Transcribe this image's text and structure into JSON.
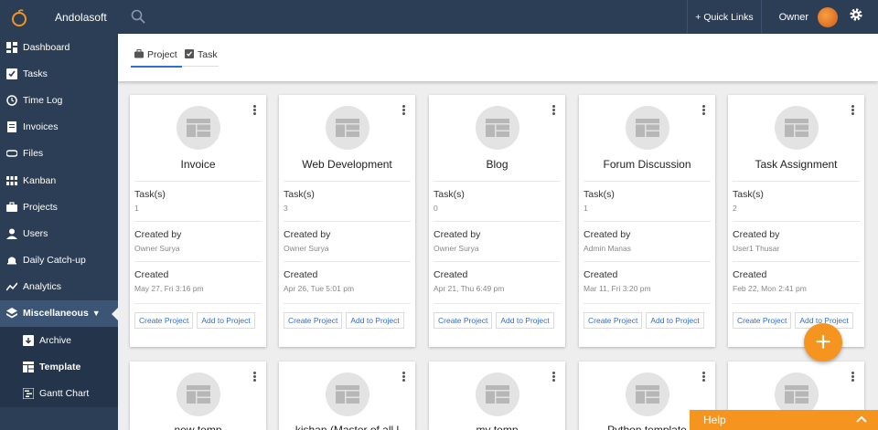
{
  "app": {
    "brand_name": "Andolasoft",
    "logo_icon": "orange-fruit-logo"
  },
  "sidebar": {
    "items": [
      {
        "label": "Dashboard",
        "icon": "dashboard-icon"
      },
      {
        "label": "Tasks",
        "icon": "tasks-icon"
      },
      {
        "label": "Time Log",
        "icon": "clock-icon"
      },
      {
        "label": "Invoices",
        "icon": "invoice-icon"
      },
      {
        "label": "Files",
        "icon": "paperclip-icon"
      },
      {
        "label": "Kanban",
        "icon": "kanban-icon"
      },
      {
        "label": "Projects",
        "icon": "briefcase-icon"
      },
      {
        "label": "Users",
        "icon": "user-icon"
      },
      {
        "label": "Daily Catch-up",
        "icon": "alarm-icon"
      },
      {
        "label": "Analytics",
        "icon": "analytics-icon"
      },
      {
        "label": "Miscellaneous",
        "icon": "layers-icon"
      }
    ],
    "sub_items": [
      {
        "label": "Archive",
        "icon": "archive-icon"
      },
      {
        "label": "Template",
        "icon": "template-icon"
      },
      {
        "label": "Gantt Chart",
        "icon": "gantt-icon"
      }
    ]
  },
  "topbar": {
    "quick_links": "+ Quick Links",
    "owner": "Owner"
  },
  "tabs": {
    "project": "Project",
    "task": "Task"
  },
  "labels": {
    "tasks": "Task(s)",
    "created_by": "Created by",
    "created": "Created",
    "create_project": "Create Project",
    "add_to_project": "Add to Project"
  },
  "cards": [
    {
      "title": "Invoice",
      "tasks": "1",
      "created_by": "Owner Surya",
      "created": "May 27, Fri 3:16 pm"
    },
    {
      "title": "Web Development",
      "tasks": "3",
      "created_by": "Owner Surya",
      "created": "Apr 26, Tue 5:01 pm"
    },
    {
      "title": "Blog",
      "tasks": "0",
      "created_by": "Owner Surya",
      "created": "Apr 21, Thu 6:49 pm"
    },
    {
      "title": "Forum Discussion",
      "tasks": "1",
      "created_by": "Admin Manas",
      "created": "Mar 11, Fri 3:20 pm"
    },
    {
      "title": "Task Assignment",
      "tasks": "2",
      "created_by": "User1 Thusar",
      "created": "Feb 22, Mon 2:41 pm"
    }
  ],
  "cards_row2": [
    {
      "title": "new temp"
    },
    {
      "title": "kishan (Master of all l"
    },
    {
      "title": "my temp"
    },
    {
      "title": "Python template"
    },
    {
      "title": ""
    }
  ],
  "fab_label": "+",
  "help": {
    "label": "Help"
  },
  "colors": {
    "sidebar_bg": "#2c3e55",
    "accent_blue": "#2d6fd3",
    "accent_orange": "#f5941f"
  }
}
